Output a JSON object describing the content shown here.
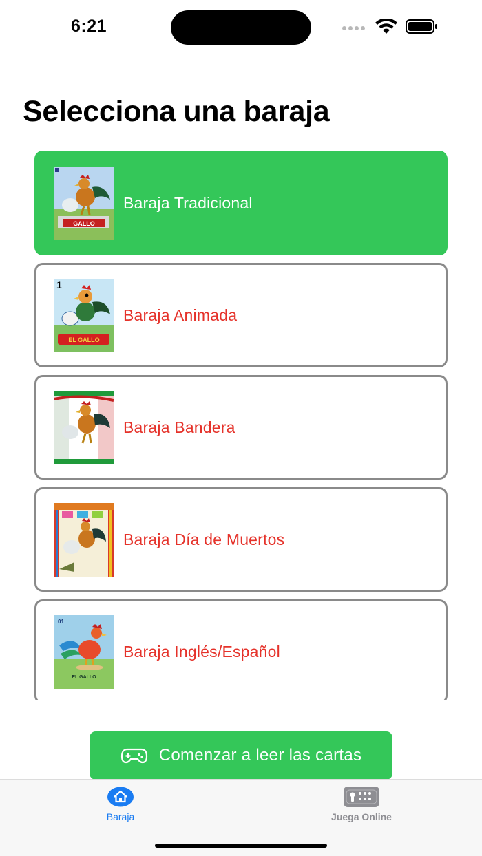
{
  "status_bar": {
    "time": "6:21"
  },
  "header": {
    "title": "Selecciona una baraja"
  },
  "decks": [
    {
      "label": "Baraja Tradicional",
      "selected": true,
      "thumbnail_icon": "rooster-card-traditional"
    },
    {
      "label": "Baraja Animada",
      "selected": false,
      "thumbnail_icon": "rooster-card-animated"
    },
    {
      "label": "Baraja Bandera",
      "selected": false,
      "thumbnail_icon": "rooster-card-flag"
    },
    {
      "label": "Baraja Día de Muertos",
      "selected": false,
      "thumbnail_icon": "rooster-card-day-of-dead"
    },
    {
      "label": "Baraja Inglés/Español",
      "selected": false,
      "thumbnail_icon": "rooster-card-english-spanish"
    }
  ],
  "start_button": {
    "label": "Comenzar a leer las cartas",
    "icon": "gamepad-icon"
  },
  "tab_bar": {
    "tabs": [
      {
        "label": "Baraja",
        "icon": "house-icon",
        "active": true
      },
      {
        "label": "Juega Online",
        "icon": "gamepad-icon",
        "active": false
      }
    ]
  },
  "colors": {
    "accent_green": "#34c759",
    "deck_label_red": "#e5322a",
    "tab_active_blue": "#1a7cf2",
    "tab_inactive_gray": "#8e8e93"
  }
}
